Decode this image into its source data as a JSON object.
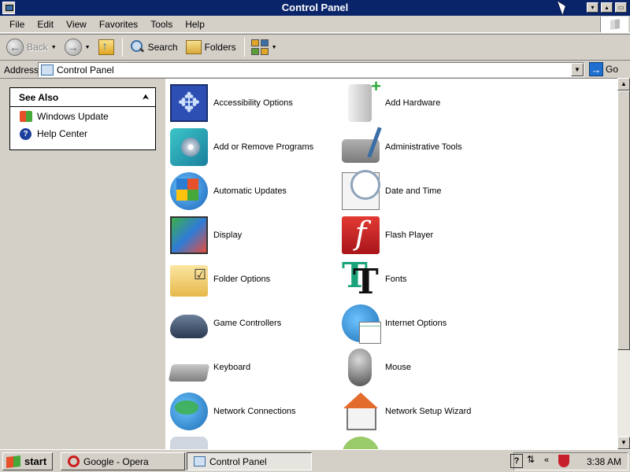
{
  "window": {
    "title": "Control Panel",
    "caption_buttons": [
      "▾",
      "▴",
      "▭"
    ]
  },
  "menu": [
    "File",
    "Edit",
    "View",
    "Favorites",
    "Tools",
    "Help"
  ],
  "toolbar": {
    "back_label": "Back",
    "search_label": "Search",
    "folders_label": "Folders"
  },
  "address": {
    "label": "Address",
    "value": "Control Panel",
    "go_label": "Go"
  },
  "see_also": {
    "title": "See Also",
    "links": [
      "Windows Update",
      "Help Center"
    ]
  },
  "items": [
    {
      "label": "Accessibility Options",
      "icon": "accessibility-icon"
    },
    {
      "label": "Add Hardware",
      "icon": "add-hardware-icon"
    },
    {
      "label": "Add or Remove Programs",
      "icon": "add-remove-programs-icon"
    },
    {
      "label": "Administrative Tools",
      "icon": "administrative-tools-icon"
    },
    {
      "label": "Automatic Updates",
      "icon": "automatic-updates-icon"
    },
    {
      "label": "Date and Time",
      "icon": "date-time-icon"
    },
    {
      "label": "Display",
      "icon": "display-icon"
    },
    {
      "label": "Flash Player",
      "icon": "flash-player-icon"
    },
    {
      "label": "Folder Options",
      "icon": "folder-options-icon"
    },
    {
      "label": "Fonts",
      "icon": "fonts-icon"
    },
    {
      "label": "Game Controllers",
      "icon": "game-controllers-icon"
    },
    {
      "label": "Internet Options",
      "icon": "internet-options-icon"
    },
    {
      "label": "Keyboard",
      "icon": "keyboard-icon"
    },
    {
      "label": "Mouse",
      "icon": "mouse-icon"
    },
    {
      "label": "Network Connections",
      "icon": "network-connections-icon"
    },
    {
      "label": "Network Setup Wizard",
      "icon": "network-setup-wizard-icon"
    }
  ],
  "taskbar": {
    "start_label": "start",
    "tasks": [
      "Google - Opera",
      "Control Panel"
    ],
    "clock": "3:38 AM"
  }
}
